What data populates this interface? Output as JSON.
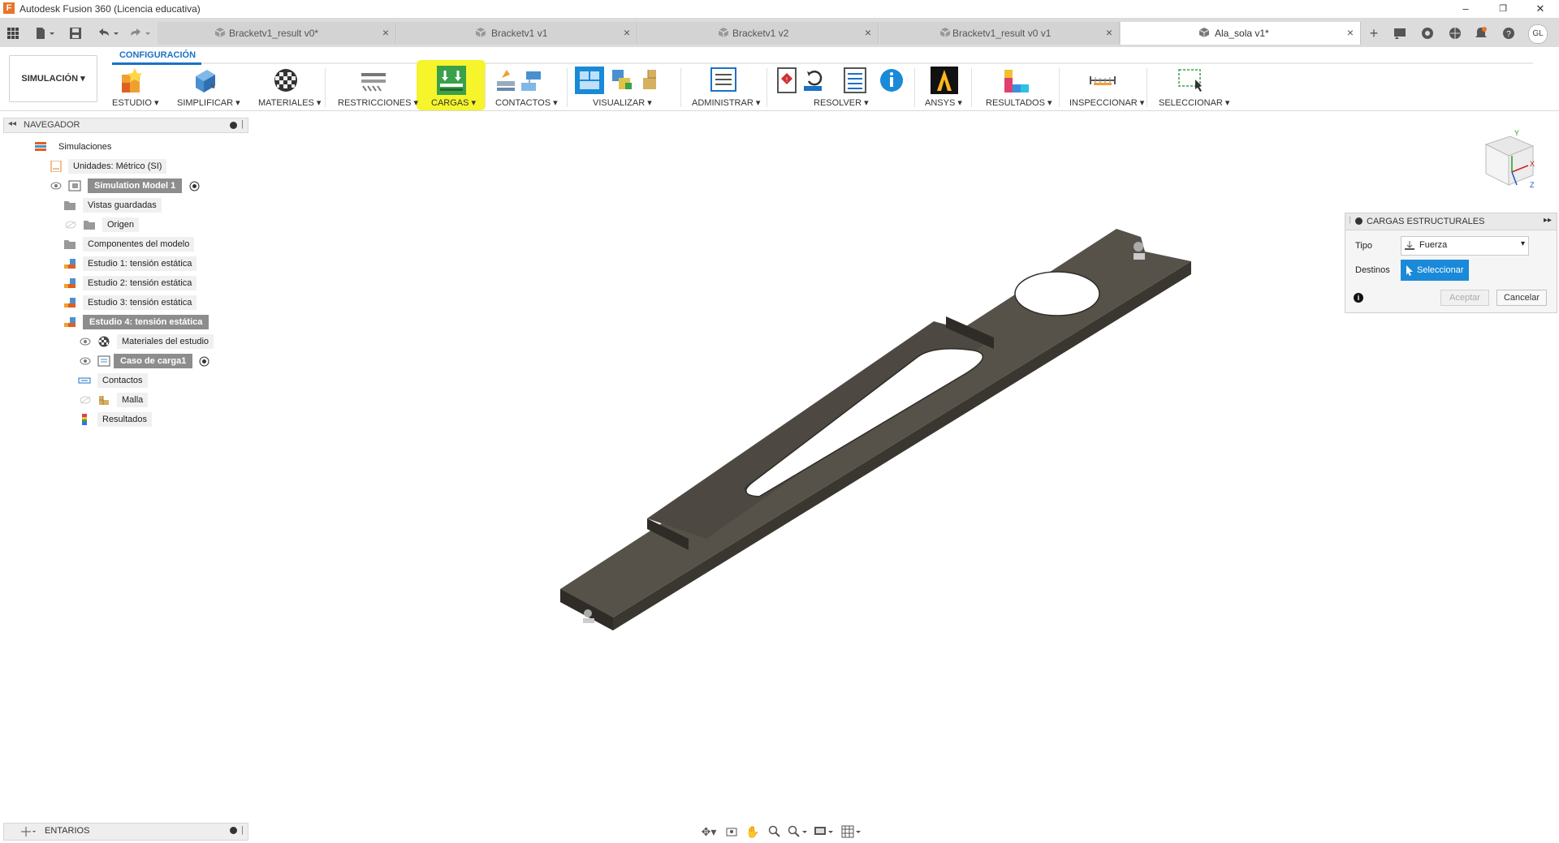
{
  "app": {
    "title": "Autodesk Fusion 360 (Licencia educativa)",
    "logo_letter": "F",
    "window_controls": [
      "–",
      "❐",
      "✕"
    ]
  },
  "tabs": [
    {
      "label": "Bracketv1_result v0*",
      "active": false
    },
    {
      "label": "Bracketv1 v1",
      "active": false
    },
    {
      "label": "Bracketv1 v2",
      "active": false
    },
    {
      "label": "Bracketv1_result v0 v1",
      "active": false
    },
    {
      "label": "Ala_sola v1*",
      "active": true
    }
  ],
  "user_initials": "GL",
  "ribbon": {
    "workspace": "SIMULACIÓN",
    "tab": "CONFIGURACIÓN",
    "groups": [
      {
        "label": "ESTUDIO",
        "icon": "study-icon"
      },
      {
        "label": "SIMPLIFICAR",
        "icon": "simplify-icon"
      },
      {
        "label": "MATERIALES",
        "icon": "materials-icon"
      },
      {
        "label": "RESTRICCIONES",
        "icon": "constraints-icon"
      },
      {
        "label": "CARGAS",
        "icon": "loads-icon"
      },
      {
        "label": "CONTACTOS",
        "icon": "contacts-icon"
      },
      {
        "label": "VISUALIZAR",
        "icon": "display-icon"
      },
      {
        "label": "ADMINISTRAR",
        "icon": "manage-icon"
      },
      {
        "label": "RESOLVER",
        "icon": "solve-icon"
      },
      {
        "label": "ANSYS",
        "icon": "ansys-icon"
      },
      {
        "label": "RESULTADOS",
        "icon": "results-icon"
      },
      {
        "label": "INSPECCIONAR",
        "icon": "inspect-icon"
      },
      {
        "label": "SELECCIONAR",
        "icon": "select-icon"
      }
    ],
    "highlight_color": "#f6f42a",
    "accent_color": "#1a72c7"
  },
  "navigator": {
    "title": "NAVEGADOR",
    "items": [
      {
        "label": "Simulaciones"
      },
      {
        "label": "Unidades: Métrico (SI)"
      },
      {
        "label": "Simulation Model 1"
      },
      {
        "label": "Vistas guardadas"
      },
      {
        "label": "Origen"
      },
      {
        "label": "Componentes del modelo"
      },
      {
        "label": "Estudio 1: tensión estática"
      },
      {
        "label": "Estudio 2: tensión estática"
      },
      {
        "label": "Estudio 3: tensión estática"
      },
      {
        "label": "Estudio 4: tensión estática"
      },
      {
        "label": "Materiales del estudio"
      },
      {
        "label": "Caso de carga1"
      },
      {
        "label": "Contactos"
      },
      {
        "label": "Malla"
      },
      {
        "label": "Resultados"
      }
    ]
  },
  "panel": {
    "title": "CARGAS ESTRUCTURALES",
    "tipo_label": "Tipo",
    "tipo_value": "Fuerza",
    "destinos_label": "Destinos",
    "seleccionar": "Seleccionar",
    "accept": "Aceptar",
    "cancel": "Cancelar"
  },
  "bottom": {
    "comments_label": "ENTARIOS"
  },
  "viewcube": {
    "axis_y": "Y",
    "axis_x": "X",
    "axis_z": "Z"
  }
}
